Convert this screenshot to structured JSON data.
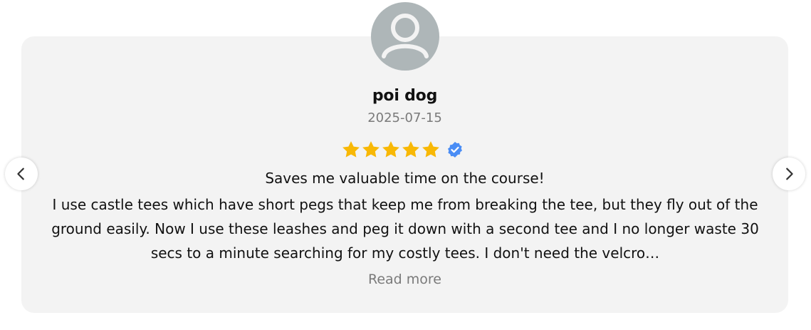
{
  "review": {
    "author": "poi dog",
    "date": "2025-07-15",
    "rating": 5,
    "rating_max": 5,
    "verified": true,
    "title": "Saves me valuable time on the course!",
    "body": "I use castle tees which have short pegs that keep me from breaking the tee, but they fly out of the ground easily. Now I use these leashes and peg it down with a second tee and I no longer waste 30 secs to a minute searching for my costly tees. I don't need the velcro…",
    "read_more_label": "Read more"
  },
  "icons": {
    "avatar": "user-avatar-icon",
    "star": "star-icon",
    "verified": "verified-badge-icon",
    "prev": "chevron-left-icon",
    "next": "chevron-right-icon"
  },
  "colors": {
    "card_background": "#f3f3f3",
    "star": "#f8b805",
    "verified": "#4a8df5",
    "avatar_background": "#aeb6b8",
    "muted_text": "#7a7a7a"
  }
}
